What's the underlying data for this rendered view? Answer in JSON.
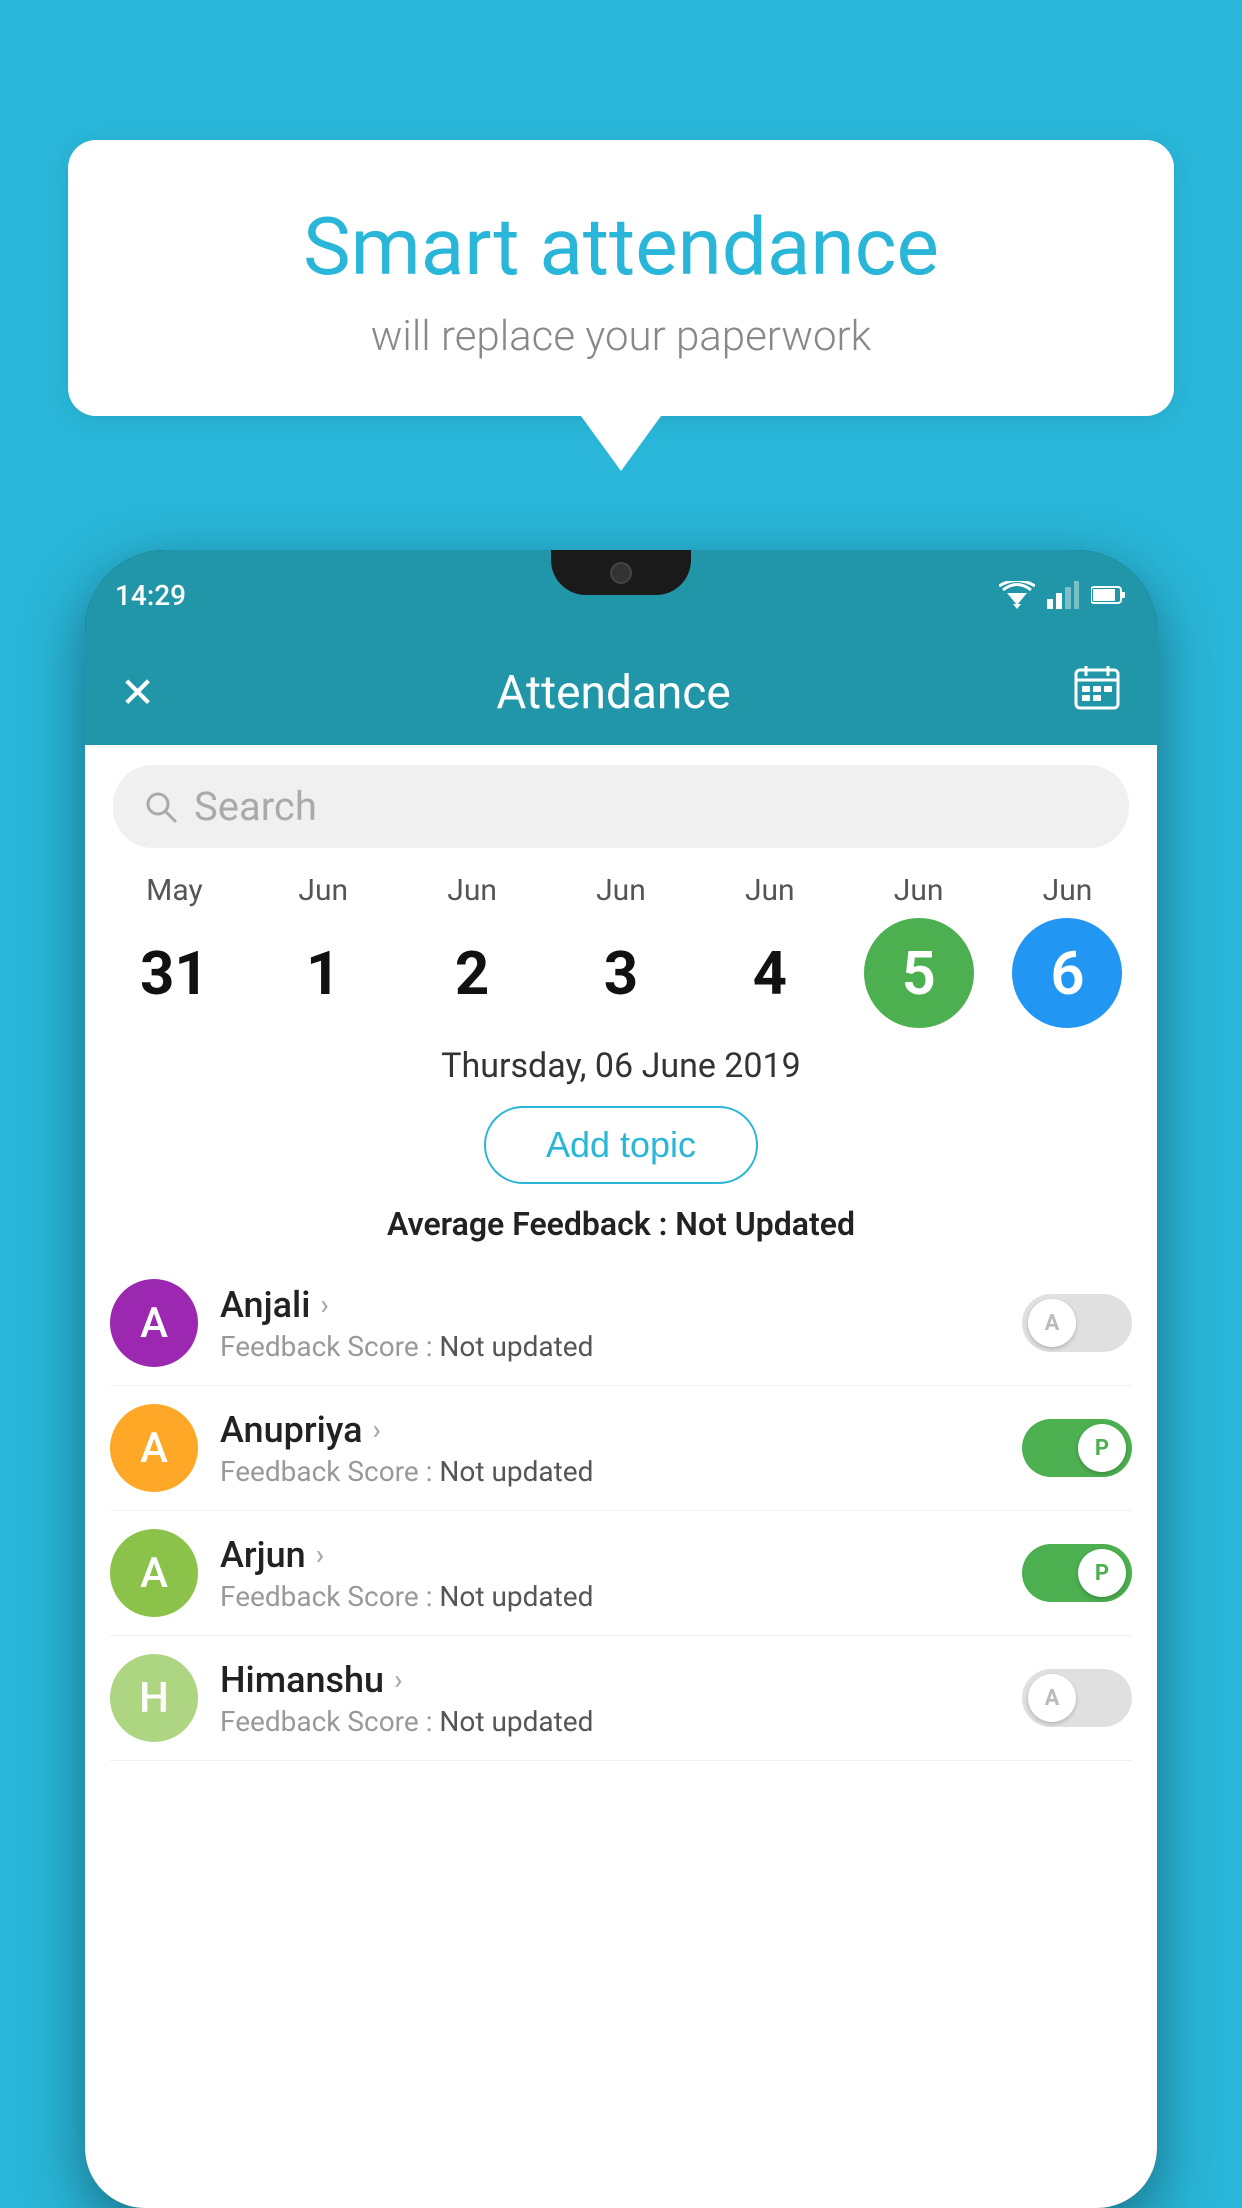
{
  "background_color": "#29b6d8",
  "speech_bubble": {
    "title": "Smart attendance",
    "subtitle": "will replace your paperwork"
  },
  "phone": {
    "status_bar": {
      "time": "14:29"
    },
    "header": {
      "title": "Attendance",
      "close_label": "✕",
      "calendar_label": "📅"
    },
    "search": {
      "placeholder": "Search"
    },
    "calendar": {
      "days": [
        {
          "month": "May",
          "date": "31",
          "style": "normal"
        },
        {
          "month": "Jun",
          "date": "1",
          "style": "normal"
        },
        {
          "month": "Jun",
          "date": "2",
          "style": "normal"
        },
        {
          "month": "Jun",
          "date": "3",
          "style": "normal"
        },
        {
          "month": "Jun",
          "date": "4",
          "style": "normal"
        },
        {
          "month": "Jun",
          "date": "5",
          "style": "active-green"
        },
        {
          "month": "Jun",
          "date": "6",
          "style": "active-blue"
        }
      ]
    },
    "selected_date": "Thursday, 06 June 2019",
    "add_topic_label": "Add topic",
    "average_feedback_label": "Average Feedback :",
    "average_feedback_value": "Not Updated",
    "students": [
      {
        "name": "Anjali",
        "avatar_letter": "A",
        "avatar_color": "#9c27b0",
        "feedback_label": "Feedback Score :",
        "feedback_value": "Not updated",
        "attendance": "absent",
        "toggle_letter": "A"
      },
      {
        "name": "Anupriya",
        "avatar_letter": "A",
        "avatar_color": "#ffa726",
        "feedback_label": "Feedback Score :",
        "feedback_value": "Not updated",
        "attendance": "present",
        "toggle_letter": "P"
      },
      {
        "name": "Arjun",
        "avatar_letter": "A",
        "avatar_color": "#8bc34a",
        "feedback_label": "Feedback Score :",
        "feedback_value": "Not updated",
        "attendance": "present",
        "toggle_letter": "P"
      },
      {
        "name": "Himanshu",
        "avatar_letter": "H",
        "avatar_color": "#aed581",
        "feedback_label": "Feedback Score :",
        "feedback_value": "Not updated",
        "attendance": "absent",
        "toggle_letter": "A"
      }
    ]
  }
}
